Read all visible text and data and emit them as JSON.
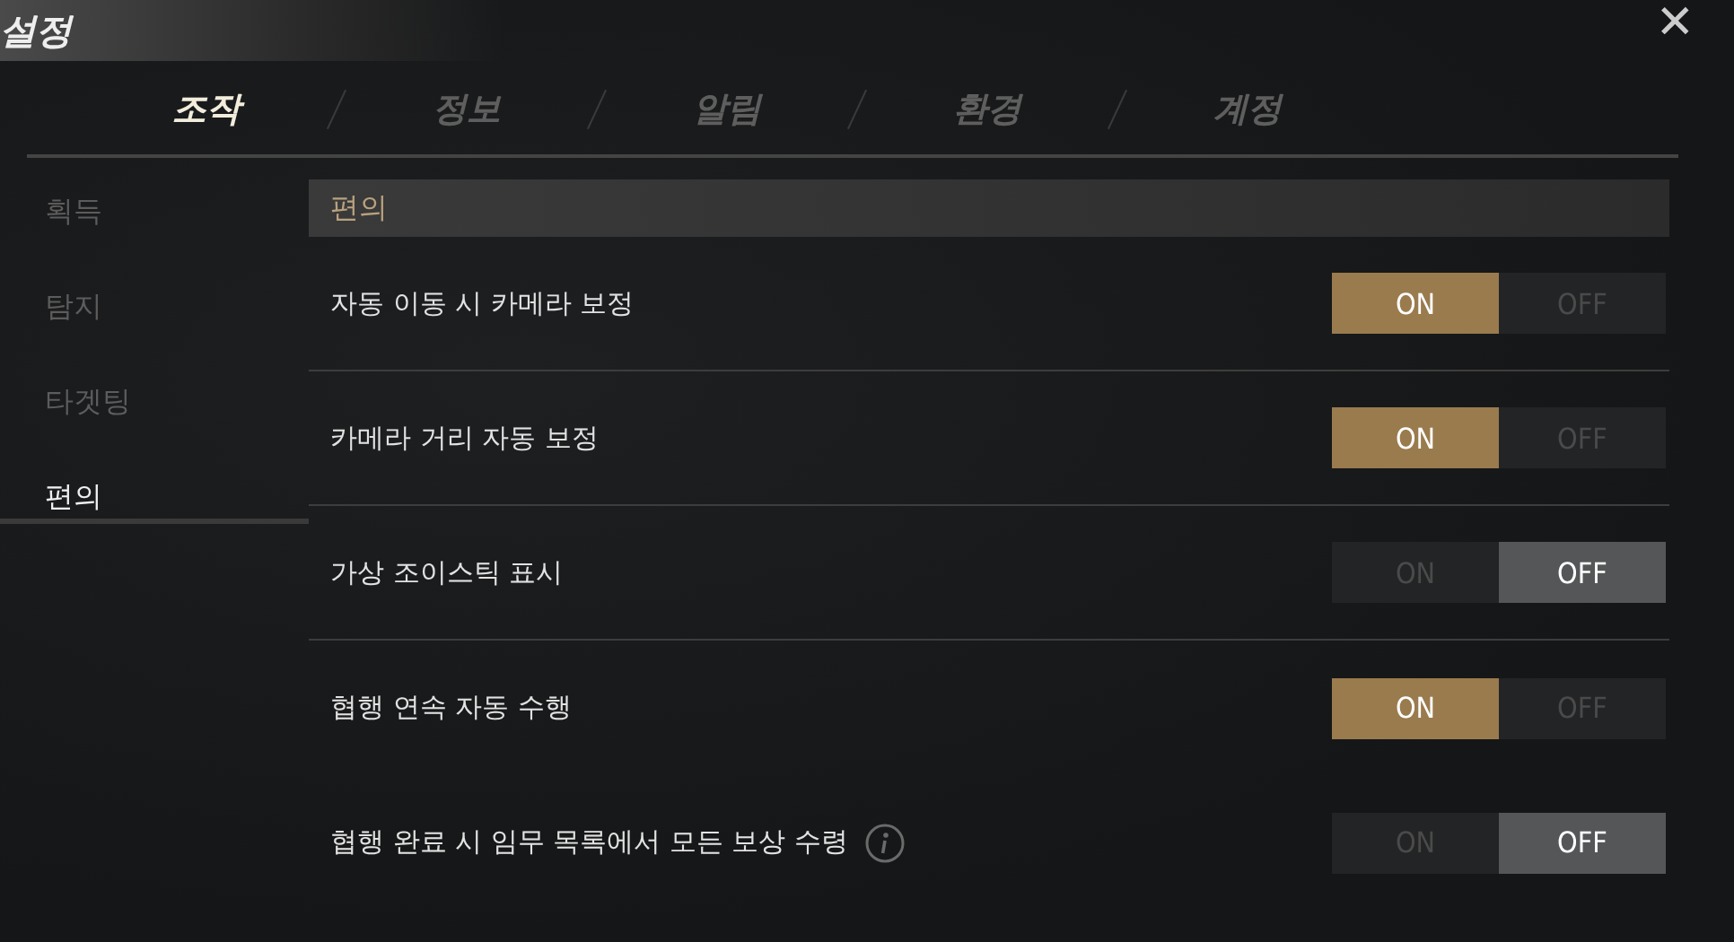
{
  "window": {
    "title": "설정",
    "close": "✕"
  },
  "tabs": [
    {
      "label": "조작",
      "selected": true
    },
    {
      "label": "정보",
      "selected": false
    },
    {
      "label": "알림",
      "selected": false
    },
    {
      "label": "환경",
      "selected": false
    },
    {
      "label": "계정",
      "selected": false
    }
  ],
  "sidebar": {
    "items": [
      {
        "label": "획득",
        "selected": false
      },
      {
        "label": "탐지",
        "selected": false
      },
      {
        "label": "타겟팅",
        "selected": false
      },
      {
        "label": "편의",
        "selected": true
      }
    ]
  },
  "section": {
    "title": "편의"
  },
  "rows": [
    {
      "label": "자동 이동 시 카메라 보정",
      "on": true,
      "info": false,
      "on_label": "ON",
      "off_label": "OFF"
    },
    {
      "label": "카메라 거리 자동 보정",
      "on": true,
      "info": false,
      "on_label": "ON",
      "off_label": "OFF"
    },
    {
      "label": "가상 조이스틱 표시",
      "on": false,
      "info": false,
      "on_label": "ON",
      "off_label": "OFF"
    },
    {
      "label": "협행 연속 자동 수행",
      "on": true,
      "info": false,
      "on_label": "ON",
      "off_label": "OFF"
    },
    {
      "label": "협행 완료 시 임무 목록에서 모든 보상 수령",
      "on": false,
      "info": true,
      "on_label": "ON",
      "off_label": "OFF"
    }
  ]
}
